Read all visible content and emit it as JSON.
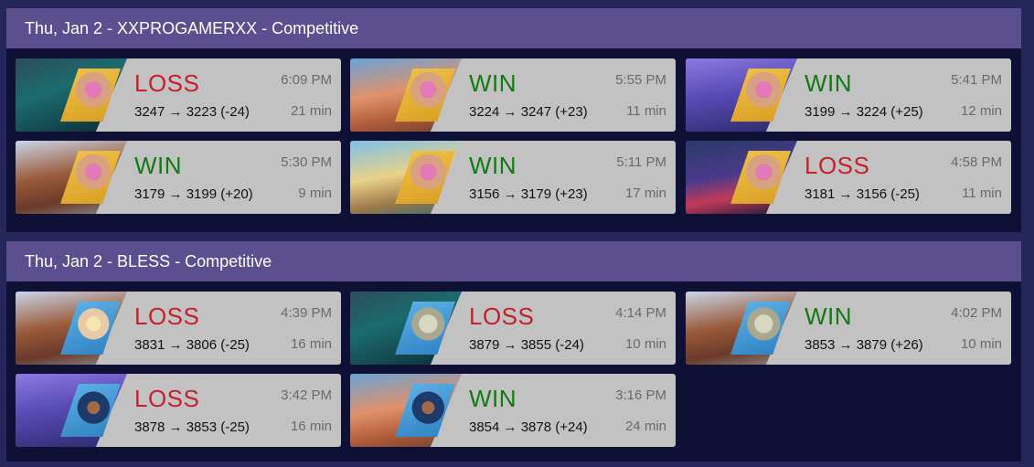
{
  "colors": {
    "page_bg": "#25275a",
    "session_bg": "#0f1035",
    "header_bg": "#5c4f8f",
    "card_bg": "#c2c2c2",
    "win": "#127a12",
    "loss": "#c8202a"
  },
  "sessions": [
    {
      "title": "Thu, Jan 2 - XXPROGAMERXX - Competitive",
      "matches": [
        {
          "result": "LOSS",
          "outcome": "loss",
          "sr": "3247 → 3223 (-24)",
          "time": "6:09 PM",
          "duration": "21 min",
          "hero_icon": "zarya-portrait-icon",
          "map_icon": "map-thumbnail-icon"
        },
        {
          "result": "WIN",
          "outcome": "win",
          "sr": "3224 → 3247 (+23)",
          "time": "5:55 PM",
          "duration": "11 min",
          "hero_icon": "zarya-portrait-icon",
          "map_icon": "map-thumbnail-icon"
        },
        {
          "result": "WIN",
          "outcome": "win",
          "sr": "3199 → 3224 (+25)",
          "time": "5:41 PM",
          "duration": "12 min",
          "hero_icon": "zarya-portrait-icon",
          "map_icon": "map-thumbnail-icon"
        },
        {
          "result": "WIN",
          "outcome": "win",
          "sr": "3179 → 3199 (+20)",
          "time": "5:30 PM",
          "duration": "9 min",
          "hero_icon": "zarya-portrait-icon",
          "map_icon": "map-thumbnail-icon"
        },
        {
          "result": "WIN",
          "outcome": "win",
          "sr": "3156 → 3179 (+23)",
          "time": "5:11 PM",
          "duration": "17 min",
          "hero_icon": "zarya-portrait-icon",
          "map_icon": "map-thumbnail-icon"
        },
        {
          "result": "LOSS",
          "outcome": "loss",
          "sr": "3181 → 3156 (-25)",
          "time": "4:58 PM",
          "duration": "11 min",
          "hero_icon": "zarya-portrait-icon",
          "map_icon": "map-thumbnail-icon"
        }
      ]
    },
    {
      "title": "Thu, Jan 2 - BLESS - Competitive",
      "matches": [
        {
          "result": "LOSS",
          "outcome": "loss",
          "sr": "3831 → 3806 (-25)",
          "time": "4:39 PM",
          "duration": "16 min",
          "hero_icon": "mercy-portrait-icon",
          "map_icon": "map-thumbnail-icon"
        },
        {
          "result": "LOSS",
          "outcome": "loss",
          "sr": "3879 → 3855 (-24)",
          "time": "4:14 PM",
          "duration": "10 min",
          "hero_icon": "zenyatta-portrait-icon",
          "map_icon": "map-thumbnail-icon"
        },
        {
          "result": "WIN",
          "outcome": "win",
          "sr": "3853 → 3879 (+26)",
          "time": "4:02 PM",
          "duration": "10 min",
          "hero_icon": "zenyatta-portrait-icon",
          "map_icon": "map-thumbnail-icon"
        },
        {
          "result": "LOSS",
          "outcome": "loss",
          "sr": "3878 → 3853 (-25)",
          "time": "3:42 PM",
          "duration": "16 min",
          "hero_icon": "ana-portrait-icon",
          "map_icon": "map-thumbnail-icon"
        },
        {
          "result": "WIN",
          "outcome": "win",
          "sr": "3854 → 3878 (+24)",
          "time": "3:16 PM",
          "duration": "24 min",
          "hero_icon": "ana-portrait-icon",
          "map_icon": "map-thumbnail-icon"
        }
      ]
    }
  ]
}
